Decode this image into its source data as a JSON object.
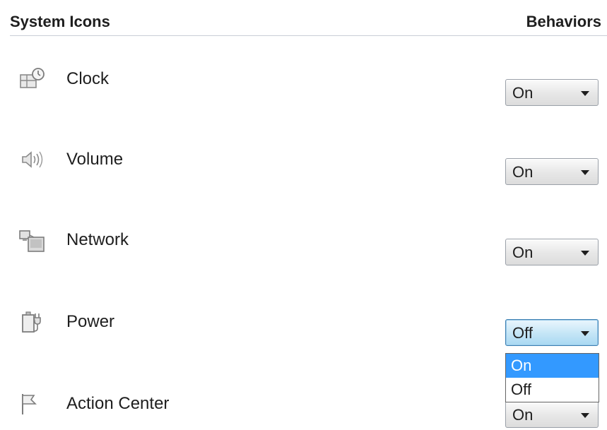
{
  "header": {
    "system_icons_label": "System Icons",
    "behaviors_label": "Behaviors"
  },
  "rows": [
    {
      "icon": "clock-icon",
      "label": "Clock",
      "value": "On"
    },
    {
      "icon": "volume-icon",
      "label": "Volume",
      "value": "On"
    },
    {
      "icon": "network-icon",
      "label": "Network",
      "value": "On"
    },
    {
      "icon": "power-icon",
      "label": "Power",
      "value": "Off"
    },
    {
      "icon": "action-center-flag-icon",
      "label": "Action Center",
      "value": "On"
    }
  ],
  "power_dropdown": {
    "options": [
      "On",
      "Off"
    ],
    "highlighted": "On"
  },
  "colors": {
    "selection_highlight": "#3399ff",
    "header_divider": "#c9ced6",
    "active_select_border": "#3c7fb1"
  }
}
